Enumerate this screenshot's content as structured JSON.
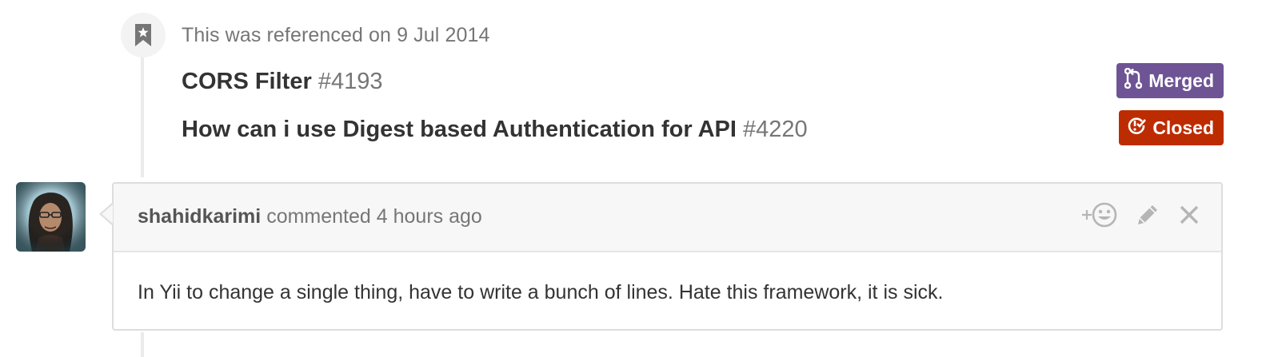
{
  "timeline_event": {
    "text": "This was referenced on 9 Jul 2014",
    "icon": "bookmark-icon"
  },
  "references": [
    {
      "title": "CORS Filter",
      "number": "#4193",
      "state": "Merged",
      "state_color": "#6e5494",
      "state_icon": "git-merge-icon"
    },
    {
      "title": "How can i use Digest based Authentication for API",
      "number": "#4220",
      "state": "Closed",
      "state_color": "#bd2c00",
      "state_icon": "issue-closed-icon"
    }
  ],
  "comment": {
    "author": "shahidkarimi",
    "action_text": "commented",
    "time": "4 hours ago",
    "body": "In Yii to change a single thing, have to write a bunch of lines. Hate this framework, it is sick.",
    "actions": {
      "reaction_icon": "add-reaction-icon",
      "edit_icon": "pencil-icon",
      "delete_icon": "close-icon"
    }
  }
}
